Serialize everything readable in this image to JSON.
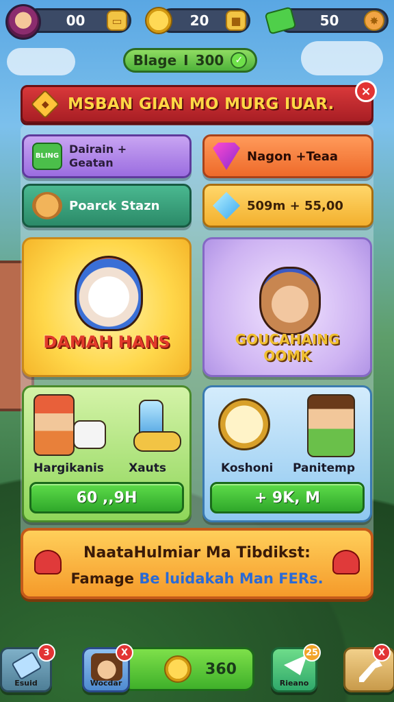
{
  "top_bar": {
    "resource_1": "00",
    "resource_2": "20",
    "resource_3": "50",
    "resource_1_icon": "ticket-icon",
    "resource_2_icon": "coin-icon",
    "resource_3_icon": "gem-icon"
  },
  "stage": {
    "label": "Blage",
    "separator": "I",
    "value": "300",
    "check": "✓"
  },
  "banner": {
    "title": "MSBAN GIAN MO MURG IUAR.",
    "close": "×"
  },
  "tiles": [
    {
      "line1": "Dairain +",
      "line2": "Geatan",
      "icon": "ticket-icon",
      "icon_text": "BLING"
    },
    {
      "label": "Nagon +Teaa",
      "icon": "gem-icon"
    },
    {
      "label": "Poarck Stazn",
      "icon": "dog-icon"
    },
    {
      "label": "509m + 55,00",
      "icon": "diamond-icon"
    }
  ],
  "cards": {
    "left": {
      "title": "DAMAH HANS"
    },
    "right": {
      "title_line1": "GOUCAHAING",
      "title_line2": "OOMK"
    }
  },
  "shop": {
    "left": {
      "label_a": "Hargikanis",
      "label_b": "Xauts",
      "button": "60 ,,9H"
    },
    "right": {
      "label_a": "Koshoni",
      "label_b": "Panitemp",
      "button": "+ 9K, M"
    }
  },
  "info": {
    "line1": "NaataHulmiar Ma Tibdikst:",
    "line2_prefix": "Famage",
    "line2_highlight": "Be luidakah Man FERs."
  },
  "bottom_nav": [
    {
      "label": "Esuid",
      "badge": "3"
    },
    {
      "label": "Wocdar",
      "badge": "X"
    },
    {
      "value": "360"
    },
    {
      "label": "Rieano",
      "badge": "25"
    },
    {
      "label": "",
      "badge": "X"
    }
  ],
  "colors": {
    "banner": "#c42a2e",
    "accent_green": "#3fb02a",
    "accent_gold": "#f3b02e"
  }
}
